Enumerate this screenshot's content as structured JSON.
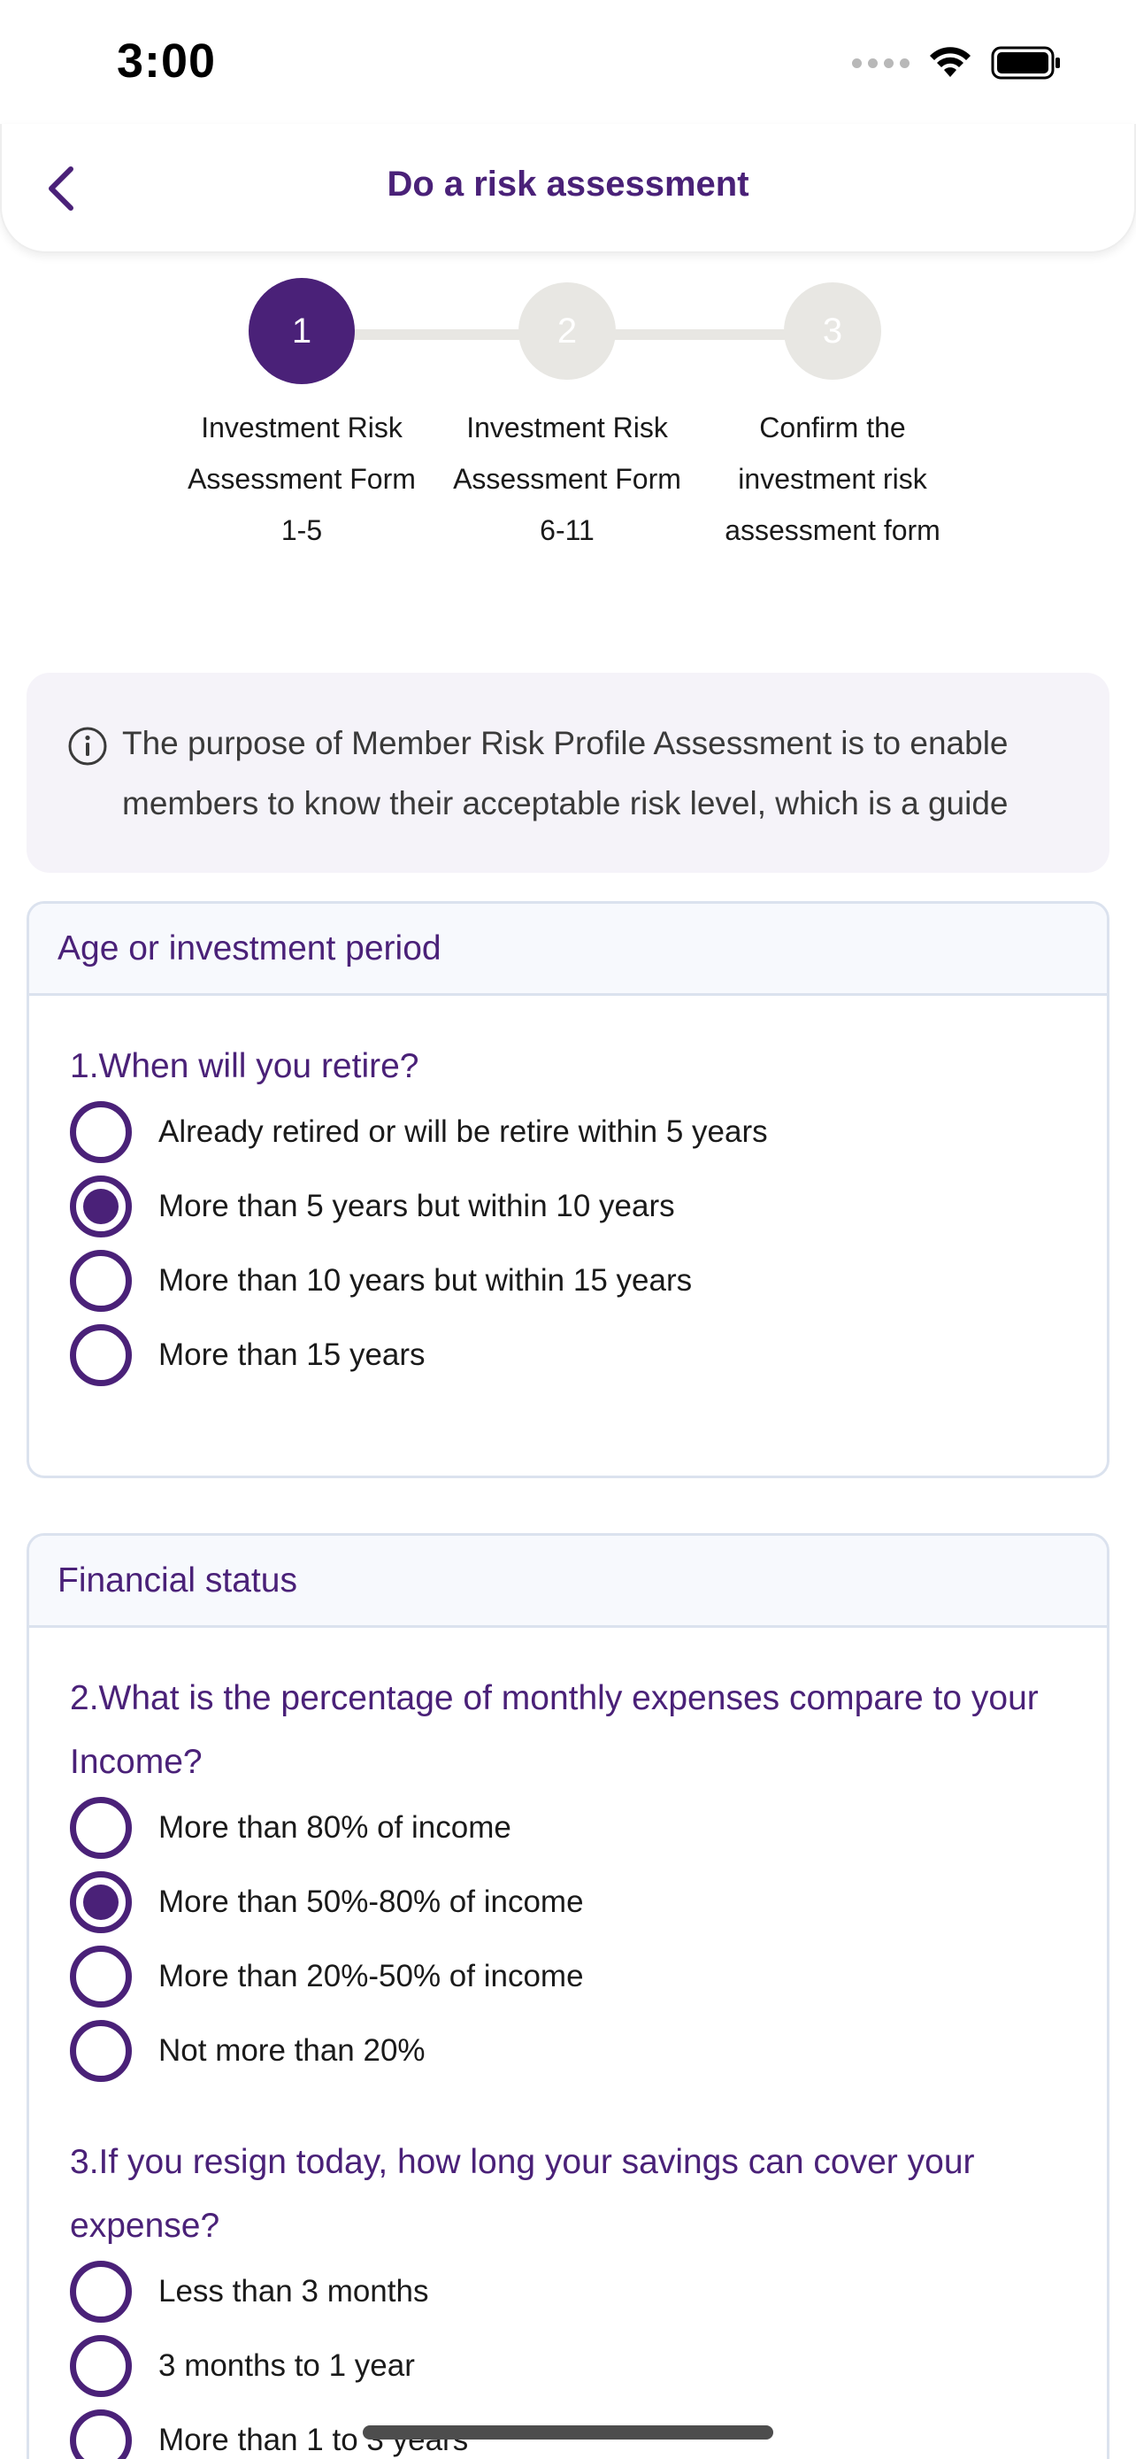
{
  "status_bar": {
    "time": "3:00"
  },
  "header": {
    "title": "Do a risk assessment"
  },
  "stepper": {
    "steps": [
      {
        "number": "1",
        "label_lines": [
          "Investment Risk",
          "Assessment Form",
          "1-5"
        ],
        "state": "active"
      },
      {
        "number": "2",
        "label_lines": [
          "Investment Risk",
          "Assessment Form",
          "6-11"
        ],
        "state": "inactive"
      },
      {
        "number": "3",
        "label_lines": [
          "Confirm the",
          "investment risk",
          "assessment form"
        ],
        "state": "inactive"
      }
    ]
  },
  "info": {
    "text": "The purpose of Member Risk Profile Assessment is to enable members to know their acceptable risk level, which is a guide"
  },
  "sections": [
    {
      "title": "Age or investment period",
      "questions": [
        {
          "text": "1.When will you retire?",
          "options": [
            {
              "label": "Already retired or will be retire within 5 years",
              "selected": false
            },
            {
              "label": "More than 5 years but within 10 years",
              "selected": true
            },
            {
              "label": "More than 10 years but within 15 years",
              "selected": false
            },
            {
              "label": "More than 15 years",
              "selected": false
            }
          ]
        }
      ]
    },
    {
      "title": "Financial status",
      "questions": [
        {
          "text": "2.What is the percentage of monthly expenses compare to your Income?",
          "options": [
            {
              "label": "More than 80% of income",
              "selected": false
            },
            {
              "label": "More than 50%-80% of income",
              "selected": true
            },
            {
              "label": "More than 20%-50% of income",
              "selected": false
            },
            {
              "label": "Not more than 20%",
              "selected": false
            }
          ]
        },
        {
          "text": "3.If you resign today, how long your savings can cover your expense?",
          "options": [
            {
              "label": "Less than 3 months",
              "selected": false
            },
            {
              "label": "3 months to 1 year",
              "selected": false
            },
            {
              "label": "More than 1 to 3 years",
              "selected": false
            }
          ]
        }
      ]
    }
  ],
  "colors": {
    "accent": "#4a2178",
    "inactive_step": "#e8e7e3",
    "info_bg": "#f5f3f9",
    "card_border": "#dbe2ee"
  }
}
